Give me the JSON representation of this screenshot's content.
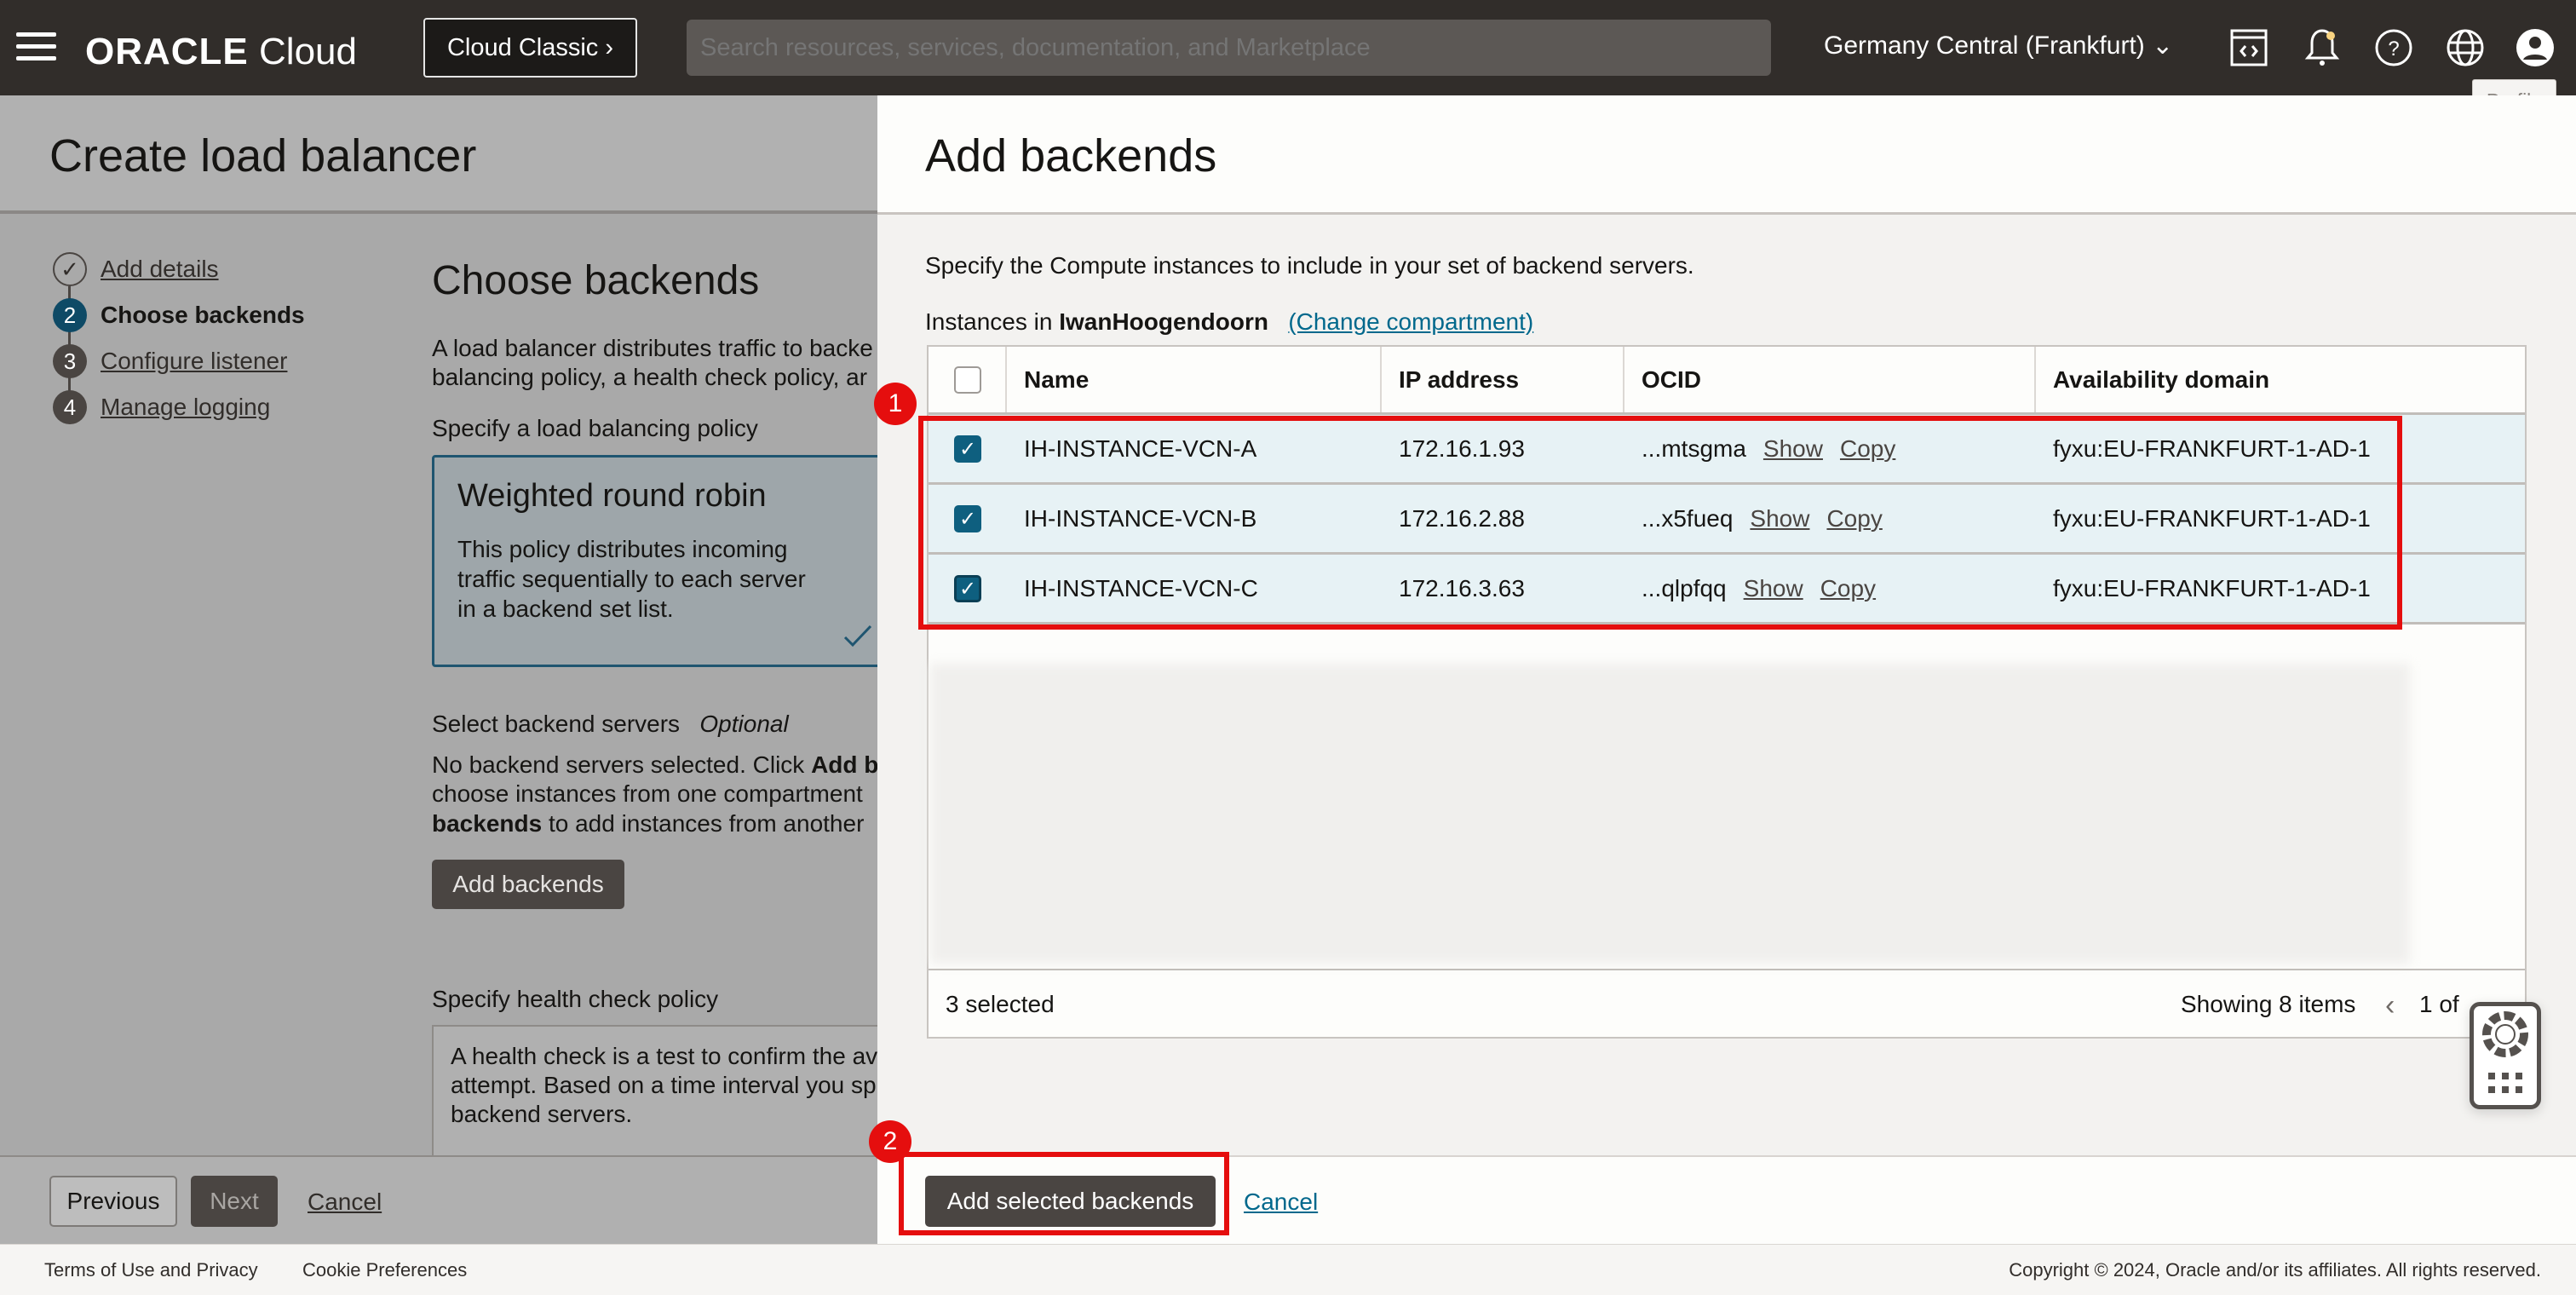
{
  "header": {
    "logo_brand": "ORACLE",
    "logo_product": "Cloud",
    "classic_button": "Cloud Classic",
    "search_placeholder": "Search resources, services, documentation, and Marketplace",
    "region": "Germany Central (Frankfurt)",
    "profile_tooltip": "Profile"
  },
  "wizard": {
    "title": "Create load balancer",
    "steps": [
      {
        "num": "✓",
        "label": "Add details"
      },
      {
        "num": "2",
        "label": "Choose backends"
      },
      {
        "num": "3",
        "label": "Configure listener"
      },
      {
        "num": "4",
        "label": "Manage logging"
      }
    ],
    "heading": "Choose backends",
    "intro_line1": "A load balancer distributes traffic to backe",
    "intro_line2": "balancing policy, a health check policy, ar",
    "policy_label": "Specify a load balancing policy",
    "policy_title": "Weighted round robin",
    "policy_desc1": "This policy distributes incoming",
    "policy_desc2": "traffic sequentially to each server",
    "policy_desc3": "in a backend set list.",
    "backend_label": "Select backend servers",
    "optional": "Optional",
    "backend_line1_a": "No backend servers selected. Click ",
    "backend_line1_b": "Add b",
    "backend_line2": "choose instances from one compartment",
    "backend_line3_a": "backends",
    "backend_line3_b": " to add instances from another",
    "add_backends_button": "Add backends",
    "health_label": "Specify health check policy",
    "health_line1": "A health check is a test to confirm the av",
    "health_line2": "attempt. Based on a time interval you sp",
    "health_line3": "backend servers.",
    "previous": "Previous",
    "next": "Next",
    "cancel": "Cancel"
  },
  "drawer": {
    "title": "Add backends",
    "description": "Specify the Compute instances to include in your set of backend servers.",
    "instances_in": "Instances in ",
    "compartment": "IwanHoogendoorn",
    "change_compartment": "(Change compartment)",
    "columns": [
      "Name",
      "IP address",
      "OCID",
      "Availability domain"
    ],
    "rows": [
      {
        "name": "IH-INSTANCE-VCN-A",
        "ip": "172.16.1.93",
        "ocid": "...mtsgma",
        "show": "Show",
        "copy": "Copy",
        "ad": "fyxu:EU-FRANKFURT-1-AD-1"
      },
      {
        "name": "IH-INSTANCE-VCN-B",
        "ip": "172.16.2.88",
        "ocid": "...x5fueq",
        "show": "Show",
        "copy": "Copy",
        "ad": "fyxu:EU-FRANKFURT-1-AD-1"
      },
      {
        "name": "IH-INSTANCE-VCN-C",
        "ip": "172.16.3.63",
        "ocid": "...qlpfqq",
        "show": "Show",
        "copy": "Copy",
        "ad": "fyxu:EU-FRANKFURT-1-AD-1"
      }
    ],
    "selected_count": "3 selected",
    "showing": "Showing 8 items",
    "page": "1 of",
    "add_selected": "Add selected backends",
    "cancel": "Cancel"
  },
  "annotations": [
    "1",
    "2"
  ],
  "footer": {
    "terms": "Terms of Use and Privacy",
    "cookies": "Cookie Preferences",
    "copyright": "Copyright © 2024, Oracle and/or its affiliates. All rights reserved."
  }
}
